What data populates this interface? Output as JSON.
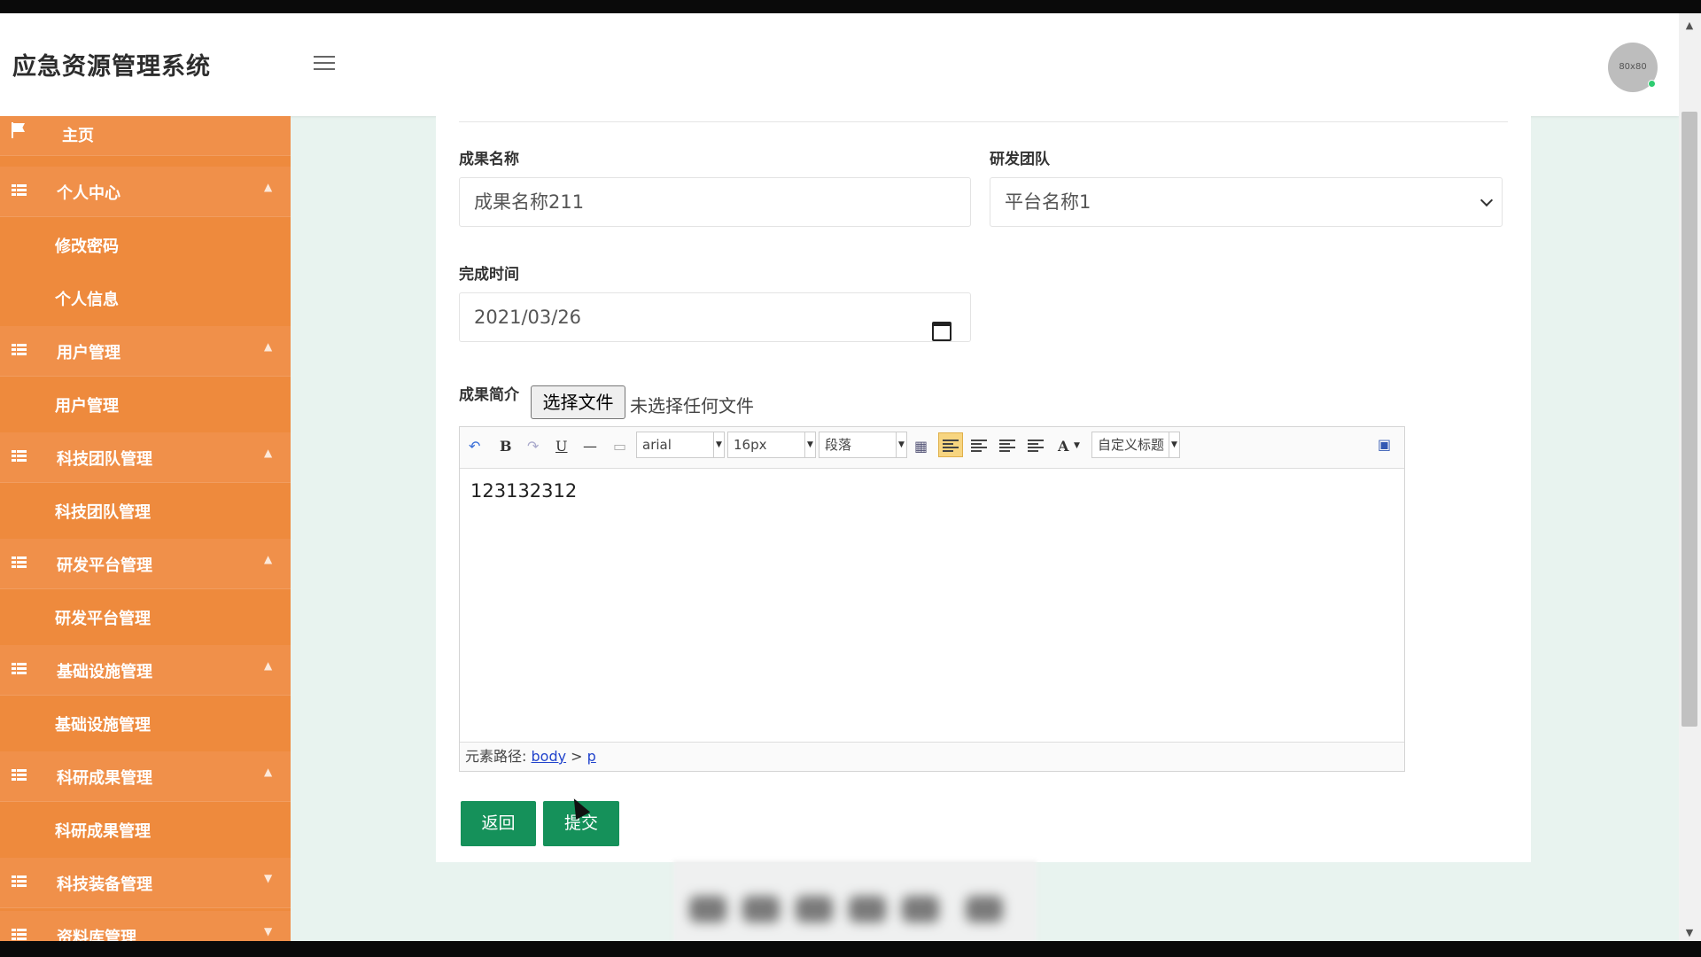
{
  "header": {
    "app_title": "应急资源管理系统",
    "avatar_text": "80x80"
  },
  "sidebar": {
    "items": [
      {
        "label": "主页",
        "type": "home"
      },
      {
        "label": "个人中心",
        "type": "parent"
      },
      {
        "label": "修改密码",
        "type": "child"
      },
      {
        "label": "个人信息",
        "type": "child"
      },
      {
        "label": "用户管理",
        "type": "parent"
      },
      {
        "label": "用户管理",
        "type": "child"
      },
      {
        "label": "科技团队管理",
        "type": "parent"
      },
      {
        "label": "科技团队管理",
        "type": "child"
      },
      {
        "label": "研发平台管理",
        "type": "parent"
      },
      {
        "label": "研发平台管理",
        "type": "child"
      },
      {
        "label": "基础设施管理",
        "type": "parent"
      },
      {
        "label": "基础设施管理",
        "type": "child"
      },
      {
        "label": "科研成果管理",
        "type": "parent"
      },
      {
        "label": "科研成果管理",
        "type": "child"
      },
      {
        "label": "科技装备管理",
        "type": "parent"
      },
      {
        "label": "资料库管理",
        "type": "parent"
      }
    ]
  },
  "form": {
    "name_label": "成果名称",
    "name_value": "成果名称211",
    "team_label": "研发团队",
    "team_value": "平台名称1",
    "date_label": "完成时间",
    "date_value": "2021/03/26",
    "intro_label": "成果简介",
    "file_button": "选择文件",
    "file_status": "未选择任何文件"
  },
  "editor": {
    "font_family": "arial",
    "font_size": "16px",
    "paragraph": "段落",
    "custom_title": "自定义标题",
    "text_color_glyph": "A",
    "content": "123132312",
    "path_label": "元素路径:",
    "path_body": "body",
    "path_sep": ">",
    "path_p": "p"
  },
  "buttons": {
    "back": "返回",
    "submit": "提交"
  },
  "colors": {
    "sidebar": "#ee8a3d",
    "primary_button": "#15915a",
    "background": "#e8f3ef"
  }
}
